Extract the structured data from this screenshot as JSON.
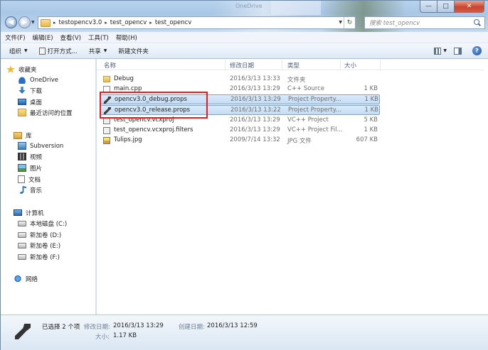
{
  "titlebar": {
    "ghost_text": "OneDrive",
    "buttons": {
      "minimize": "—",
      "maximize": "□",
      "close": "✕"
    }
  },
  "address": {
    "segments": [
      "testopencv3.0",
      "test_opencv",
      "test_opencv"
    ],
    "separator": "▸"
  },
  "search": {
    "placeholder": "搜索 test_opencv"
  },
  "menu": [
    "文件(F)",
    "编辑(E)",
    "查看(V)",
    "工具(T)",
    "帮助(H)"
  ],
  "commands": {
    "organize": "组织",
    "open_with": "打开方式...",
    "share": "共享",
    "new_folder": "新建文件夹"
  },
  "nav": {
    "favorites": "收藏夹",
    "onedrive": "OneDrive",
    "downloads": "下载",
    "desktop": "桌面",
    "recent": "最近访问的位置",
    "libraries": "库",
    "subversion": "Subversion",
    "videos": "视频",
    "pictures": "图片",
    "documents": "文档",
    "music": "音乐",
    "computer": "计算机",
    "drive_c": "本地磁盘 (C:)",
    "drive_d": "新加卷 (D:)",
    "drive_e": "新加卷 (E:)",
    "drive_f": "新加卷 (F:)",
    "network": "网络"
  },
  "columns": {
    "name": "名称",
    "date": "修改日期",
    "type": "类型",
    "size": "大小"
  },
  "files": [
    {
      "name": "Debug",
      "date": "2016/3/13 13:33",
      "type": "文件夹",
      "size": "",
      "icon": "folder-icon",
      "selected": false
    },
    {
      "name": "main.cpp",
      "date": "2016/3/13 13:29",
      "type": "C++ Source",
      "size": "1 KB",
      "icon": "cpp-file-icon",
      "selected": false
    },
    {
      "name": "opencv3.0_debug.props",
      "date": "2016/3/13 13:29",
      "type": "Project Property...",
      "size": "1 KB",
      "icon": "wrench-icon",
      "selected": true
    },
    {
      "name": "opencv3.0_release.props",
      "date": "2016/3/13 13:22",
      "type": "Project Property...",
      "size": "1 KB",
      "icon": "wrench-icon",
      "selected": true
    },
    {
      "name": "test_opencv.vcxproj",
      "date": "2016/3/13 13:29",
      "type": "VC++ Project",
      "size": "5 KB",
      "icon": "vcxproj-icon",
      "selected": false
    },
    {
      "name": "test_opencv.vcxproj.filters",
      "date": "2016/3/13 13:29",
      "type": "VC++ Project Fil...",
      "size": "1 KB",
      "icon": "filters-icon",
      "selected": false
    },
    {
      "name": "Tulips.jpg",
      "date": "2009/7/14 13:32",
      "type": "JPG 文件",
      "size": "607 KB",
      "icon": "image-icon",
      "selected": false
    }
  ],
  "details": {
    "count": "已选择 2 个项",
    "modified_label": "修改日期:",
    "modified_value": "2016/3/13 13:29",
    "created_label": "创建日期:",
    "created_value": "2016/3/13 12:59",
    "size_label": "大小:",
    "size_value": "1.17 KB"
  },
  "colors": {
    "highlight": "#e02020",
    "selection": "#c2dcf3"
  }
}
